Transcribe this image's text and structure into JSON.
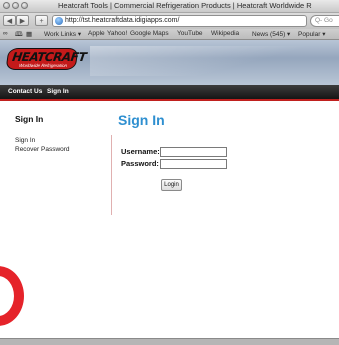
{
  "window": {
    "title": "Heatcraft Tools | Commercial Refrigeration Products | Heatcraft Worldwide R"
  },
  "toolbar": {
    "back_icon": "back-arrow",
    "forward_icon": "forward-arrow",
    "add_label": "+",
    "url": "http://tst.heatcraftdata.idigiapps.com/",
    "reload_label": "C",
    "search_placeholder": "Q- Go"
  },
  "bookmarks": {
    "items": [
      "Work Links ▾",
      "Apple",
      "Yahoo!",
      "Google Maps",
      "YouTube",
      "Wikipedia",
      "News (545) ▾",
      "Popular ▾"
    ]
  },
  "logo": {
    "name": "HEATCRAFT",
    "tagline": "Worldwide Refrigeration"
  },
  "nav": {
    "contact_us": "Contact Us",
    "sign_in": "Sign In"
  },
  "sidebar": {
    "title": "Sign In",
    "items": [
      "Sign In",
      "Recover Password"
    ]
  },
  "main": {
    "title": "Sign In",
    "username_label": "Username:",
    "username_value": "",
    "password_label": "Password:",
    "password_value": "",
    "login_label": "Login"
  },
  "colors": {
    "brand_red": "#c41a1a",
    "title_blue": "#2e8fd0",
    "nav_dark": "#1f1f1f",
    "annotation_red": "#e5232a"
  }
}
